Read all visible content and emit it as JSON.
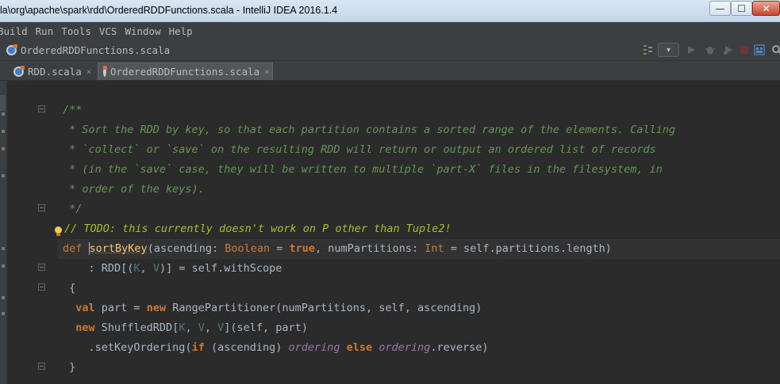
{
  "window": {
    "title": "la\\org\\apache\\spark\\rdd\\OrderedRDDFunctions.scala - IntelliJ IDEA 2016.1.4",
    "min_glyph": "—",
    "max_glyph": "☐",
    "close_glyph": "✕"
  },
  "menu": [
    "Build",
    "Run",
    "Tools",
    "VCS",
    "Window",
    "Help"
  ],
  "breadcrumb": {
    "file": "OrderedRDDFunctions.scala"
  },
  "toolbar": {
    "dropdown_glyph": "▾"
  },
  "tabs": [
    {
      "label": "RDD.scala",
      "close": "×",
      "active": false
    },
    {
      "label": "OrderedRDDFunctions.scala",
      "close": "×",
      "active": true
    }
  ],
  "code": {
    "doc": [
      "/**",
      " * Sort the RDD by key, so that each partition contains a sorted range of the elements. Calling",
      " * `collect` or `save` on the resulting RDD will return or output an ordered list of records",
      " * (in the `save` case, they will be written to multiple `part-X` files in the filesystem, in",
      " * order of the keys).",
      " */"
    ],
    "todo": "// TODO: this currently doesn't work on P other than Tuple2!",
    "def_kw": "def",
    "fn_name": "sortByKey",
    "sig_open": "(ascending: ",
    "t_boolean": "Boolean",
    "eq": " = ",
    "kw_true": "true",
    "comma_np": ", numPartitions: ",
    "t_int": "Int",
    "sig_close": " = self.partitions.length)",
    "ret_open": "    : RDD[(",
    "tp_k": "K",
    "tp_comma": ", ",
    "tp_v": "V",
    "ret_close": ")] = self.withScope",
    "brace_open": " {",
    "kw_val": "val",
    "val_rest": " part = ",
    "kw_new": "new",
    "range_part": " RangePartitioner(numPartitions, self, ascending)",
    "shuffled_start": " ShuffledRDD[",
    "shuffled_end": "](self, part)",
    "set_key": "    .setKeyOrdering(",
    "kw_if": "if",
    "if_cond": " (ascending) ",
    "ordering": "ordering",
    "kw_else": "else",
    "reverse": ".reverse)",
    "brace_close": " }"
  }
}
